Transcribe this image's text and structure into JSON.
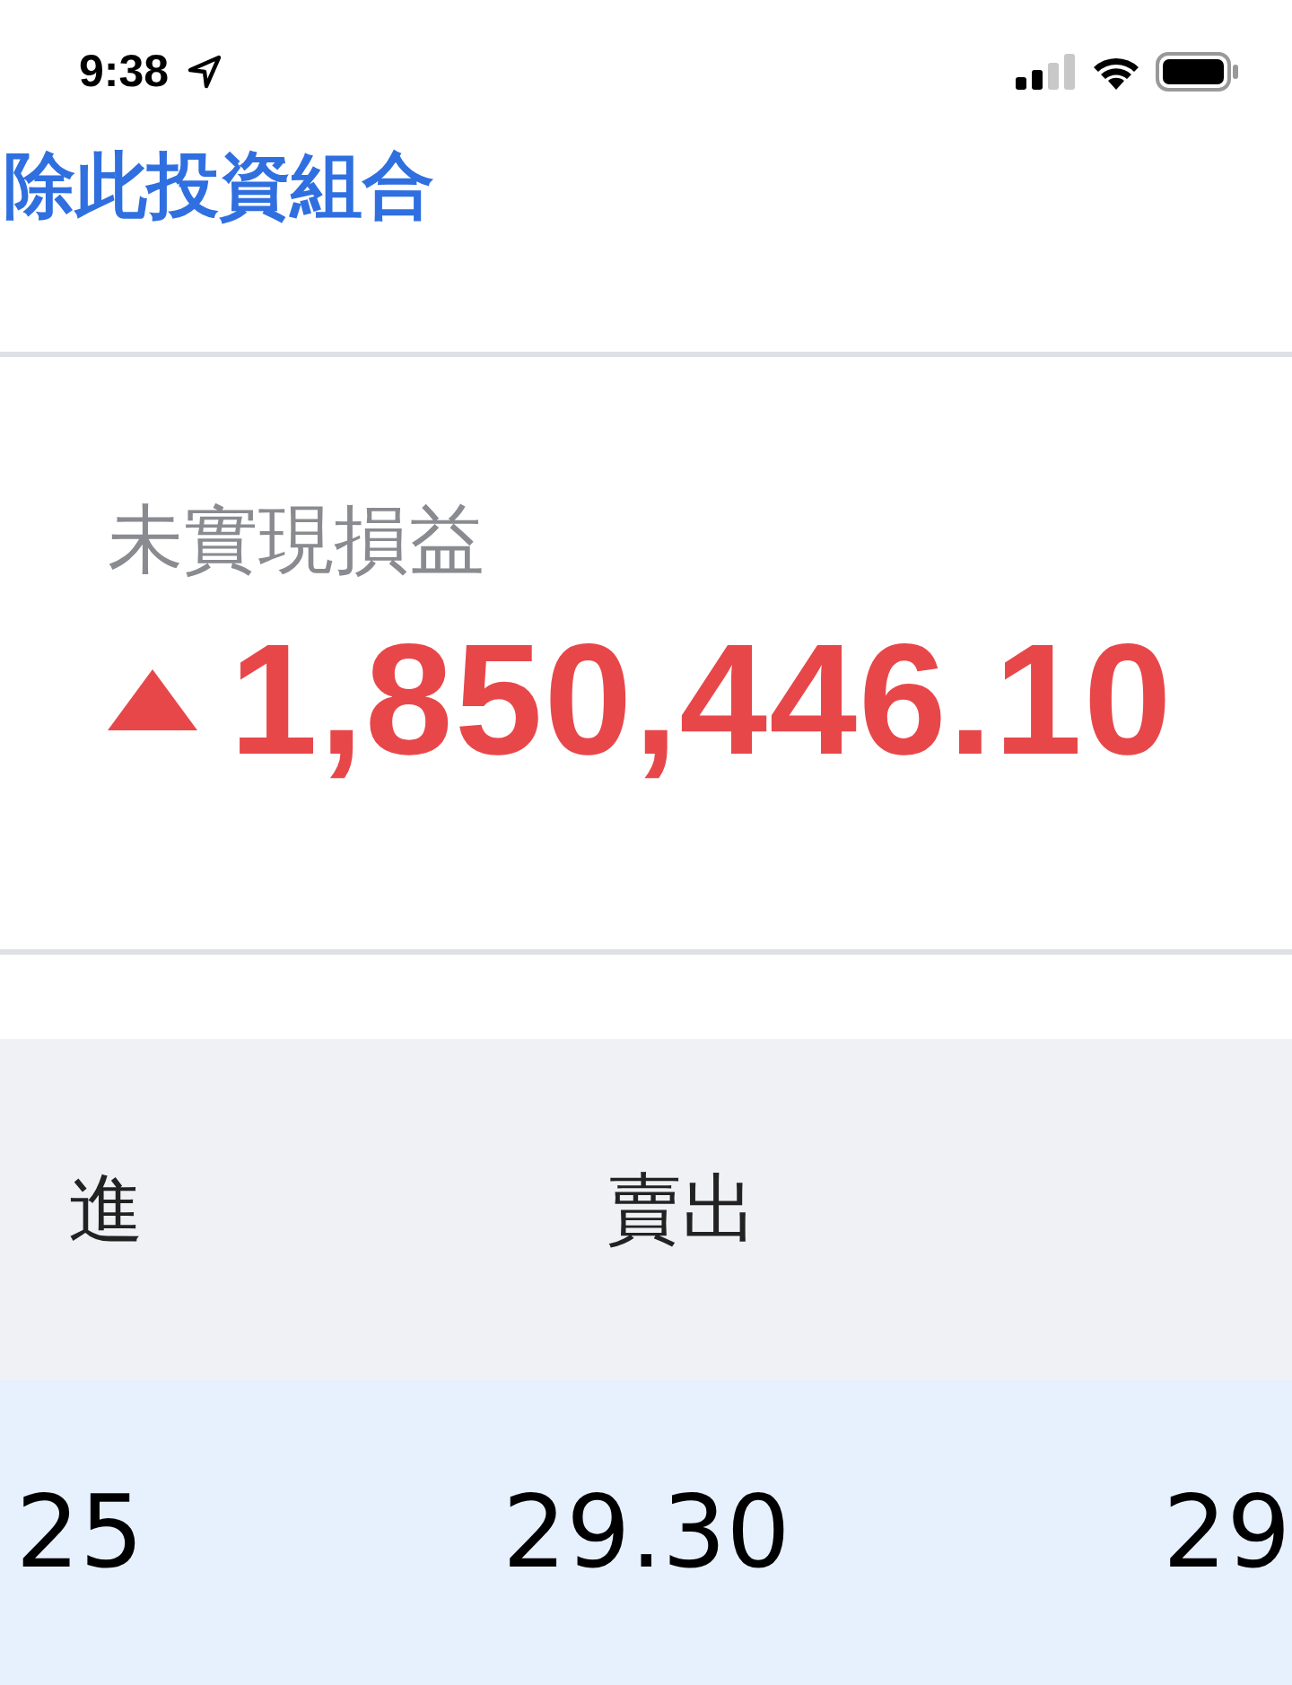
{
  "status_bar": {
    "time": "9:38"
  },
  "header": {
    "title": "除此投資組合"
  },
  "summary": {
    "label": "未實現損益",
    "rising": true,
    "value": "1,850,446.10"
  },
  "table": {
    "columns": [
      "進",
      "賣出"
    ],
    "rows": [
      {
        "selected": true,
        "cells": [
          "25",
          "29.30",
          "29"
        ]
      }
    ]
  }
}
